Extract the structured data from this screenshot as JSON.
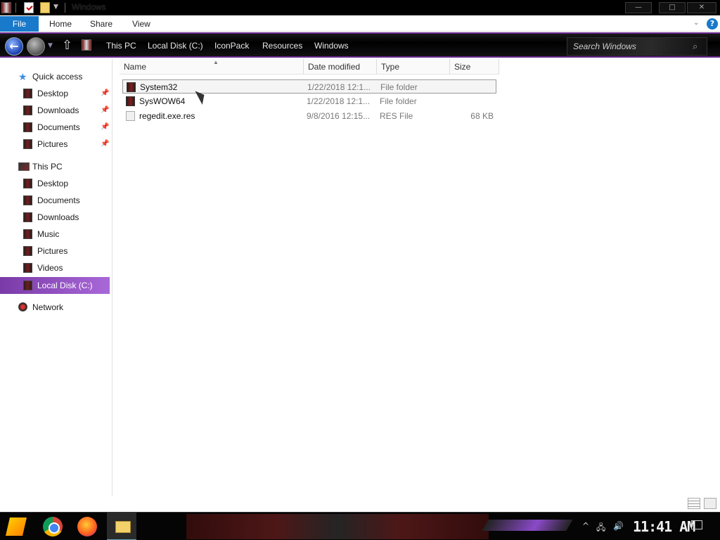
{
  "window": {
    "title": "Windows",
    "controls": {
      "minimize": "—",
      "maximize": "□",
      "close": "✕"
    }
  },
  "ribbon": {
    "tabs": [
      "File",
      "Home",
      "Share",
      "View"
    ],
    "help": "?"
  },
  "address_bar": {
    "crumbs": [
      "This PC",
      "Local Disk (C:)",
      "IconPack",
      "Resources",
      "Windows"
    ],
    "search_placeholder": "Search Windows"
  },
  "nav_pane": {
    "quick_access": "Quick access",
    "quick_items": [
      "Desktop",
      "Downloads",
      "Documents",
      "Pictures"
    ],
    "this_pc": "This PC",
    "pc_items": [
      "Desktop",
      "Documents",
      "Downloads",
      "Music",
      "Pictures",
      "Videos"
    ],
    "selected": "Local Disk (C:)",
    "network": "Network"
  },
  "file_list": {
    "columns": [
      "Name",
      "Date modified",
      "Type",
      "Size"
    ],
    "rows": [
      {
        "name": "System32",
        "date": "1/22/2018 12:1...",
        "type": "File folder",
        "size": ""
      },
      {
        "name": "SysWOW64",
        "date": "1/22/2018 12:1...",
        "type": "File folder",
        "size": ""
      },
      {
        "name": "regedit.exe.res",
        "date": "9/8/2016 12:15...",
        "type": "RES File",
        "size": "68 KB"
      }
    ],
    "selected_row": 0
  },
  "taskbar": {
    "apps": [
      "start-icon",
      "chrome-icon",
      "firefox-icon",
      "file-explorer-icon"
    ],
    "clock": "11:41 AM"
  }
}
